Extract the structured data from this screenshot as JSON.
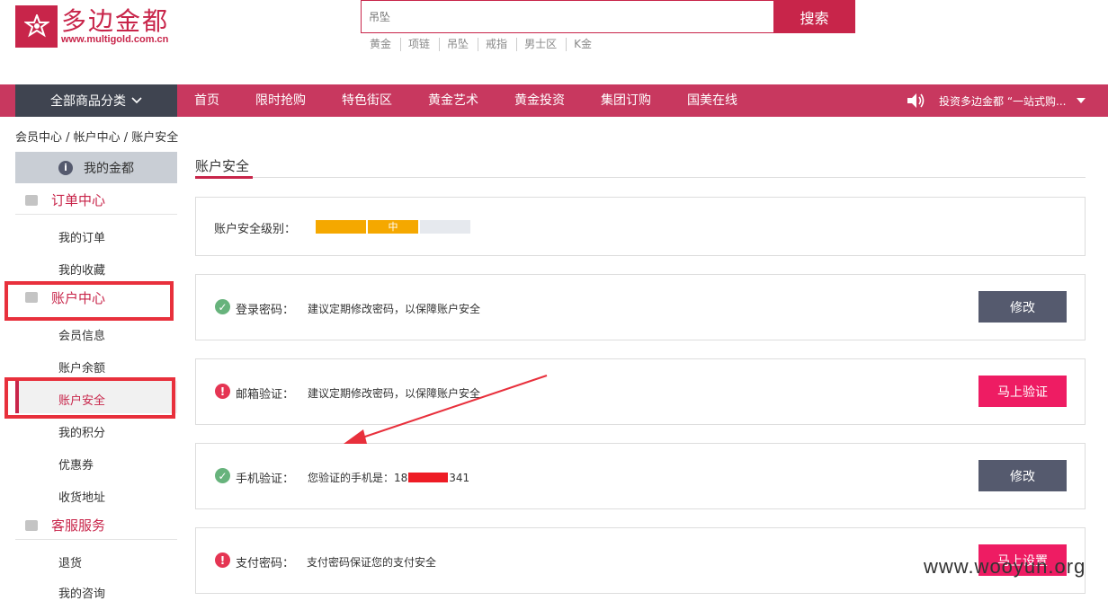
{
  "header": {
    "logo_text": "多边金都",
    "logo_url": "www.multigold.com.cn",
    "search": {
      "placeholder": "吊坠",
      "button": "搜索"
    },
    "hot_words": [
      "黄金",
      "项链",
      "吊坠",
      "戒指",
      "男士区",
      "K金"
    ]
  },
  "nav": {
    "category_button": "全部商品分类",
    "items": [
      "首页",
      "限时抢购",
      "特色街区",
      "黄金艺术",
      "黄金投资",
      "集团订购",
      "国美在线"
    ],
    "notice": "投资多边金都 “一站式购..."
  },
  "breadcrumb": "会员中心 / 帐户中心 / 账户安全",
  "sidebar": {
    "my_gold": "我的金都",
    "sections": [
      {
        "title": "订单中心",
        "links": [
          "我的订单",
          "我的收藏"
        ]
      },
      {
        "title": "账户中心",
        "links": [
          "会员信息",
          "账户余额",
          "账户安全",
          "我的积分",
          "优惠券",
          "收货地址"
        ]
      },
      {
        "title": "客服服务",
        "links": [
          "退货",
          "我的咨询"
        ]
      }
    ],
    "active_link": "账户安全"
  },
  "main": {
    "title": "账户安全",
    "level": {
      "label": "账户安全级别：",
      "value": "中",
      "filled_segments": 2,
      "total_segments": 3
    },
    "rows": [
      {
        "label": "登录密码：",
        "desc": "建议定期修改密码，以保障账户安全",
        "status": "ok",
        "button": "修改"
      },
      {
        "label": "邮箱验证：",
        "desc": "建议定期修改密码，以保障账户安全",
        "status": "warn",
        "button": "马上验证"
      },
      {
        "label": "手机验证：",
        "desc_prefix": "您验证的手机是：18",
        "desc_suffix": "341",
        "status": "ok",
        "button": "修改"
      },
      {
        "label": "支付密码：",
        "desc": "支付密码保证您的支付安全",
        "status": "warn",
        "button": "马上设置"
      }
    ]
  },
  "watermark": "www.wooyun.org",
  "colors": {
    "brand": "#c8254a",
    "nav": "#c8385f",
    "btn_gray": "#555a6e",
    "btn_pink": "#ee1c63",
    "level_fill": "#f5a800",
    "annotation": "#e8303c"
  }
}
